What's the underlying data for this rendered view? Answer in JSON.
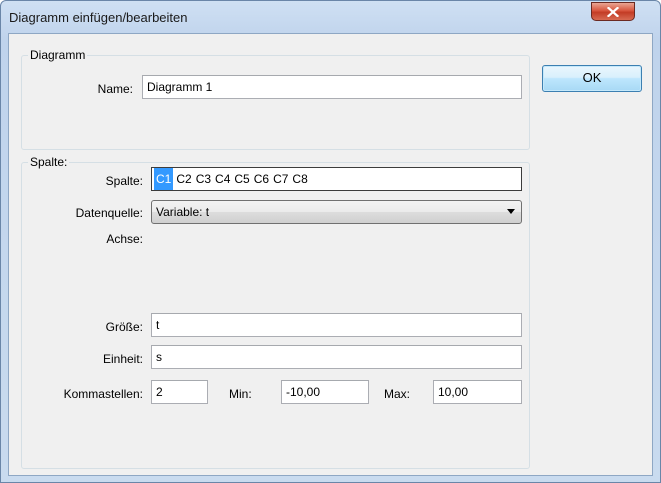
{
  "window": {
    "title": "Diagramm einfügen/bearbeiten",
    "close_icon": "close-icon"
  },
  "buttons": {
    "ok_label": "OK"
  },
  "diagram_group": {
    "title": "Diagramm",
    "name_label": "Name:",
    "name_value": "Diagramm 1"
  },
  "column_group": {
    "title": "Spalte:",
    "spalte_label": "Spalte:",
    "columns": [
      "C1",
      "C2",
      "C3",
      "C4",
      "C5",
      "C6",
      "C7",
      "C8"
    ],
    "selected_column": "C1",
    "datasource_label": "Datenquelle:",
    "datasource_value": "Variable: t",
    "axis_label": "Achse:",
    "size_label": "Größe:",
    "size_value": "t",
    "unit_label": "Einheit:",
    "unit_value": "s",
    "decimals_label": "Kommastellen:",
    "decimals_value": "2",
    "min_label": "Min:",
    "min_value": "-10,00",
    "max_label": "Max:",
    "max_value": "10,00"
  },
  "colors": {
    "selection": "#3399ff",
    "close_button": "#c33c25",
    "dialog_background": "#f0f0f0"
  }
}
